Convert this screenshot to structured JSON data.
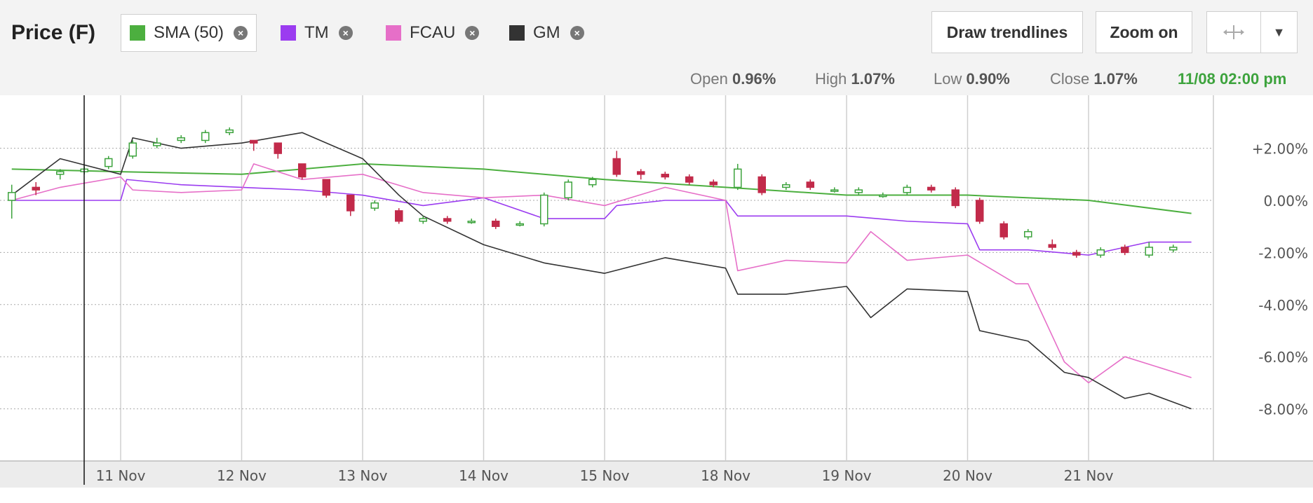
{
  "header": {
    "title": "Price (F)",
    "legend": [
      {
        "label": "SMA (50)",
        "color": "#4caf3f",
        "icon": "close-icon"
      },
      {
        "label": "TM",
        "color": "#9b3cf0",
        "icon": "close-icon"
      },
      {
        "label": "FCAU",
        "color": "#e66fc8",
        "icon": "close-icon"
      },
      {
        "label": "GM",
        "color": "#333333",
        "icon": "close-icon"
      }
    ],
    "buttons": {
      "draw_trendlines": "Draw trendlines",
      "zoom_on": "Zoom on",
      "crosshair_icon": "crosshair-icon",
      "dropdown_icon": "chevron-down-icon"
    },
    "ohlc": {
      "open_label": "Open",
      "open_value": "0.96%",
      "high_label": "High",
      "high_value": "1.07%",
      "low_label": "Low",
      "low_value": "0.90%",
      "close_label": "Close",
      "close_value": "1.07%"
    },
    "timestamp": "11/08 02:00 pm",
    "timestamp_color": "#3da33d"
  },
  "chart_data": {
    "type": "line",
    "title": "",
    "xlabel": "",
    "ylabel": "",
    "x_ticks": [
      "11 Nov",
      "12 Nov",
      "13 Nov",
      "14 Nov",
      "15 Nov",
      "18 Nov",
      "19 Nov",
      "20 Nov",
      "21 Nov"
    ],
    "y_ticks": [
      "+2.00%",
      "0.00%",
      "-2.00%",
      "-4.00%",
      "-6.00%",
      "-8.00%"
    ],
    "ylim": [
      -10,
      3.7
    ],
    "grid": true,
    "crosshair_at": "11/08 02:00 pm",
    "series": [
      {
        "name": "SMA (50)",
        "color": "#4caf3f",
        "x": [
          -0.9,
          0,
          1,
          2,
          3,
          4,
          5,
          6,
          7,
          8,
          8.85
        ],
        "values": [
          1.2,
          1.1,
          1.0,
          1.4,
          1.2,
          0.8,
          0.5,
          0.2,
          0.2,
          0.0,
          -0.5
        ]
      },
      {
        "name": "TM",
        "color": "#9b3cf0",
        "x": [
          -0.9,
          -0.5,
          0,
          0.05,
          0.5,
          1,
          1.5,
          2,
          2.5,
          3,
          3.5,
          4,
          4.1,
          4.5,
          5,
          5.1,
          6,
          6.5,
          7,
          7.1,
          7.5,
          8,
          8.5,
          8.85
        ],
        "values": [
          0.0,
          0.0,
          0.0,
          0.8,
          0.6,
          0.5,
          0.4,
          0.2,
          -0.2,
          0.1,
          -0.7,
          -0.7,
          -0.2,
          0.0,
          0.0,
          -0.6,
          -0.6,
          -0.8,
          -0.9,
          -1.9,
          -1.9,
          -2.1,
          -1.6,
          -1.6
        ]
      },
      {
        "name": "FCAU",
        "color": "#e66fc8",
        "x": [
          -0.9,
          -0.5,
          0,
          0.1,
          0.5,
          1,
          1.1,
          1.5,
          2,
          2.5,
          3,
          3.5,
          4,
          4.5,
          5,
          5.1,
          5.5,
          6,
          6.2,
          6.5,
          7,
          7.4,
          7.5,
          7.8,
          8,
          8.3,
          8.85
        ],
        "values": [
          0.0,
          0.5,
          0.9,
          0.4,
          0.3,
          0.4,
          1.4,
          0.8,
          1.0,
          0.3,
          0.1,
          0.2,
          -0.2,
          0.5,
          0.0,
          -2.7,
          -2.3,
          -2.4,
          -1.2,
          -2.3,
          -2.1,
          -3.2,
          -3.2,
          -6.2,
          -7.0,
          -6.0,
          -6.8
        ]
      },
      {
        "name": "GM",
        "color": "#333333",
        "x": [
          -0.9,
          -0.5,
          0,
          0.1,
          0.5,
          1,
          1.5,
          2,
          2.3,
          2.5,
          3,
          3.5,
          4,
          4.5,
          5,
          5.1,
          5.5,
          6,
          6.2,
          6.5,
          7,
          7.1,
          7.5,
          7.8,
          8,
          8.3,
          8.5,
          8.85
        ],
        "values": [
          0.2,
          1.6,
          1.0,
          2.4,
          2.0,
          2.2,
          2.6,
          1.6,
          0.2,
          -0.6,
          -1.7,
          -2.4,
          -2.8,
          -2.2,
          -2.6,
          -3.6,
          -3.6,
          -3.3,
          -4.5,
          -3.4,
          -3.5,
          -5.0,
          -5.4,
          -6.6,
          -6.8,
          -7.6,
          -7.4,
          -8.0
        ]
      }
    ],
    "candles": {
      "up_color": "#3da33d",
      "down_color": "#c22a4a",
      "x": [
        -0.9,
        -0.7,
        -0.5,
        -0.3,
        -0.1,
        0.1,
        0.3,
        0.5,
        0.7,
        0.9,
        1.1,
        1.3,
        1.5,
        1.7,
        1.9,
        2.1,
        2.3,
        2.5,
        2.7,
        2.9,
        3.1,
        3.3,
        3.5,
        3.7,
        3.9,
        4.1,
        4.3,
        4.5,
        4.7,
        4.9,
        5.1,
        5.3,
        5.5,
        5.7,
        5.9,
        6.1,
        6.3,
        6.5,
        6.7,
        6.9,
        7.1,
        7.3,
        7.5,
        7.7,
        7.9,
        8.1,
        8.3,
        8.5,
        8.7
      ],
      "open": [
        0.0,
        0.5,
        1.0,
        1.1,
        1.3,
        1.7,
        2.1,
        2.3,
        2.3,
        2.6,
        2.3,
        2.2,
        1.4,
        0.8,
        0.2,
        -0.3,
        -0.4,
        -0.8,
        -0.7,
        -0.8,
        -0.8,
        -0.9,
        -0.9,
        0.1,
        0.6,
        1.6,
        1.1,
        1.0,
        0.9,
        0.7,
        0.5,
        0.9,
        0.5,
        0.7,
        0.4,
        0.3,
        0.2,
        0.3,
        0.5,
        0.4,
        0.0,
        -0.9,
        -1.4,
        -1.7,
        -2.0,
        -2.1,
        -1.8,
        -2.1,
        -1.9
      ],
      "close": [
        0.3,
        0.4,
        1.1,
        1.2,
        1.6,
        2.2,
        2.2,
        2.4,
        2.6,
        2.7,
        2.2,
        1.8,
        0.9,
        0.2,
        -0.4,
        -0.1,
        -0.8,
        -0.7,
        -0.8,
        -0.8,
        -1.0,
        -0.9,
        0.2,
        0.7,
        0.8,
        1.0,
        1.0,
        0.9,
        0.7,
        0.6,
        1.2,
        0.3,
        0.6,
        0.5,
        0.4,
        0.4,
        0.2,
        0.5,
        0.4,
        -0.2,
        -0.8,
        -1.4,
        -1.2,
        -1.8,
        -2.1,
        -1.9,
        -2.0,
        -1.8,
        -1.8
      ],
      "high": [
        0.6,
        0.7,
        1.2,
        1.3,
        1.7,
        2.3,
        2.4,
        2.5,
        2.7,
        2.8,
        2.3,
        2.2,
        1.4,
        0.8,
        0.2,
        0.0,
        -0.3,
        -0.6,
        -0.6,
        -0.7,
        -0.7,
        -0.8,
        0.3,
        0.8,
        0.9,
        1.9,
        1.2,
        1.1,
        1.0,
        0.8,
        1.4,
        1.0,
        0.7,
        0.8,
        0.5,
        0.5,
        0.3,
        0.6,
        0.6,
        0.5,
        0.1,
        -0.8,
        -1.1,
        -1.5,
        -1.9,
        -1.8,
        -1.7,
        -1.6,
        -1.7
      ],
      "low": [
        -0.7,
        0.2,
        0.8,
        1.0,
        1.2,
        1.6,
        2.0,
        2.2,
        2.2,
        2.5,
        1.9,
        1.6,
        0.8,
        0.1,
        -0.6,
        -0.4,
        -0.9,
        -0.9,
        -0.9,
        -0.9,
        -1.1,
        -1.0,
        -1.0,
        0.0,
        0.5,
        0.9,
        0.8,
        0.8,
        0.6,
        0.5,
        0.4,
        0.2,
        0.4,
        0.4,
        0.3,
        0.2,
        0.1,
        0.2,
        0.3,
        -0.3,
        -0.9,
        -1.5,
        -1.5,
        -1.9,
        -2.2,
        -2.2,
        -2.1,
        -2.2,
        -2.0
      ]
    }
  }
}
